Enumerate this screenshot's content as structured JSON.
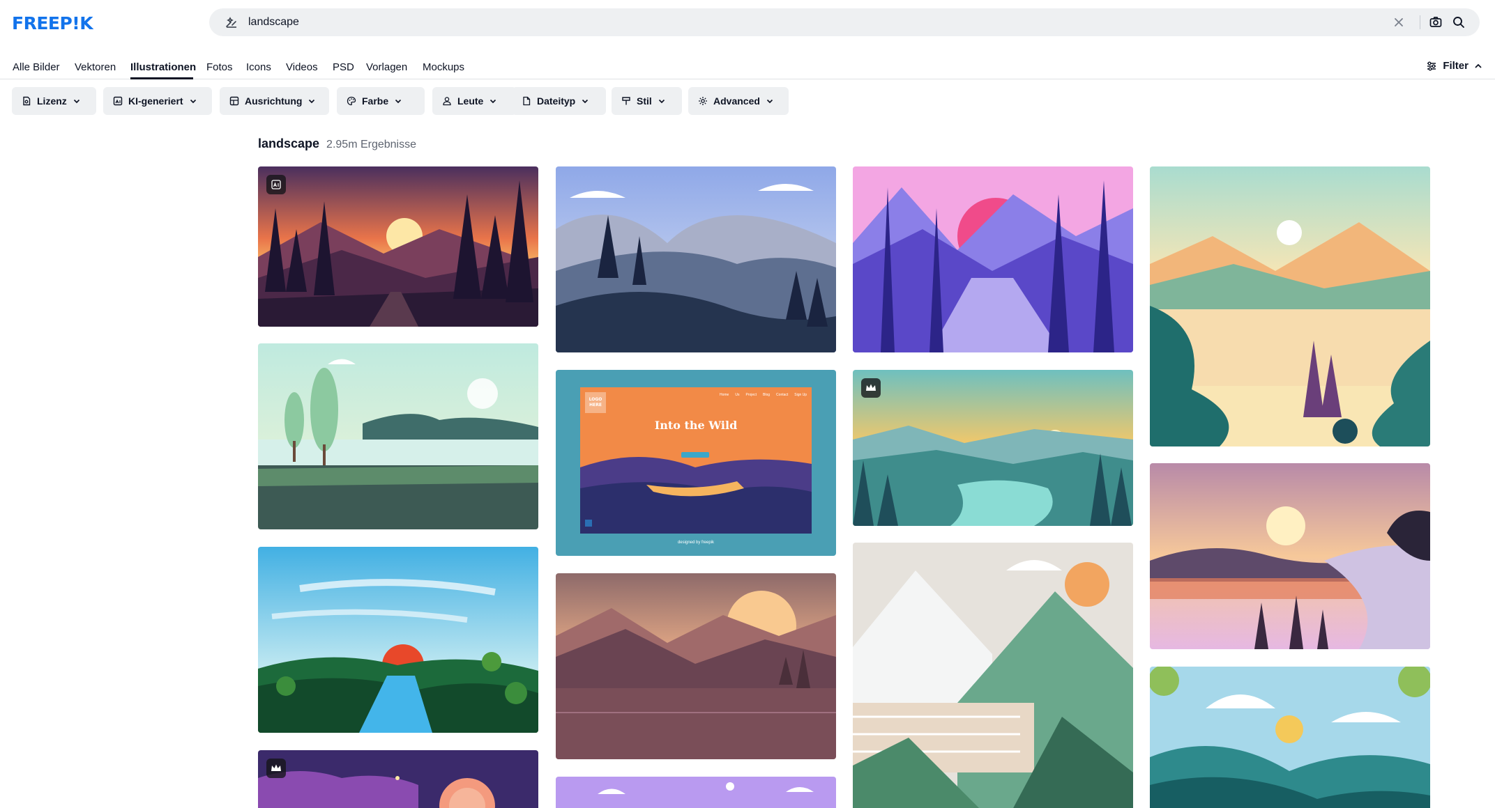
{
  "brand": {
    "logo_text": "FREEP!K",
    "accent": "#1273eb"
  },
  "search": {
    "value": "landscape",
    "placeholder": ""
  },
  "tabs": [
    {
      "label": "Alle Bilder",
      "active": false
    },
    {
      "label": "Vektoren",
      "active": false
    },
    {
      "label": "Illustrationen",
      "active": true
    },
    {
      "label": "Fotos",
      "active": false
    },
    {
      "label": "Icons",
      "active": false
    },
    {
      "label": "Videos",
      "active": false
    },
    {
      "label": "PSD",
      "active": false
    },
    {
      "label": "Vorlagen",
      "active": false
    },
    {
      "label": "Mockups",
      "active": false
    }
  ],
  "filter_toggle": {
    "label": "Filter",
    "icon": "sliders-icon",
    "state": "expanded"
  },
  "filters": [
    {
      "label": "Lizenz",
      "icon": "license-icon"
    },
    {
      "label": "KI-generiert",
      "icon": "ai-image-icon"
    },
    {
      "label": "Ausrichtung",
      "icon": "orientation-icon"
    },
    {
      "label": "Farbe",
      "icon": "palette-icon"
    },
    {
      "label": "Leute",
      "icon": "people-icon"
    },
    {
      "label": "Dateityp",
      "icon": "file-icon"
    },
    {
      "label": "Stil",
      "icon": "brush-icon"
    },
    {
      "label": "Advanced",
      "icon": "gear-icon"
    }
  ],
  "results": {
    "query": "landscape",
    "count": "2.95m Ergebnisse"
  },
  "template_card": {
    "logo_text": "LOGO HERE",
    "headline": "Into the Wild",
    "nav": [
      "Home",
      "Us",
      "Project",
      "Blog",
      "Contact",
      "Sign Up"
    ],
    "credit": "designed by freepik"
  },
  "badges": {
    "ai_badge_icon": "ai-generated-icon",
    "premium_badge_icon": "crown-icon"
  }
}
